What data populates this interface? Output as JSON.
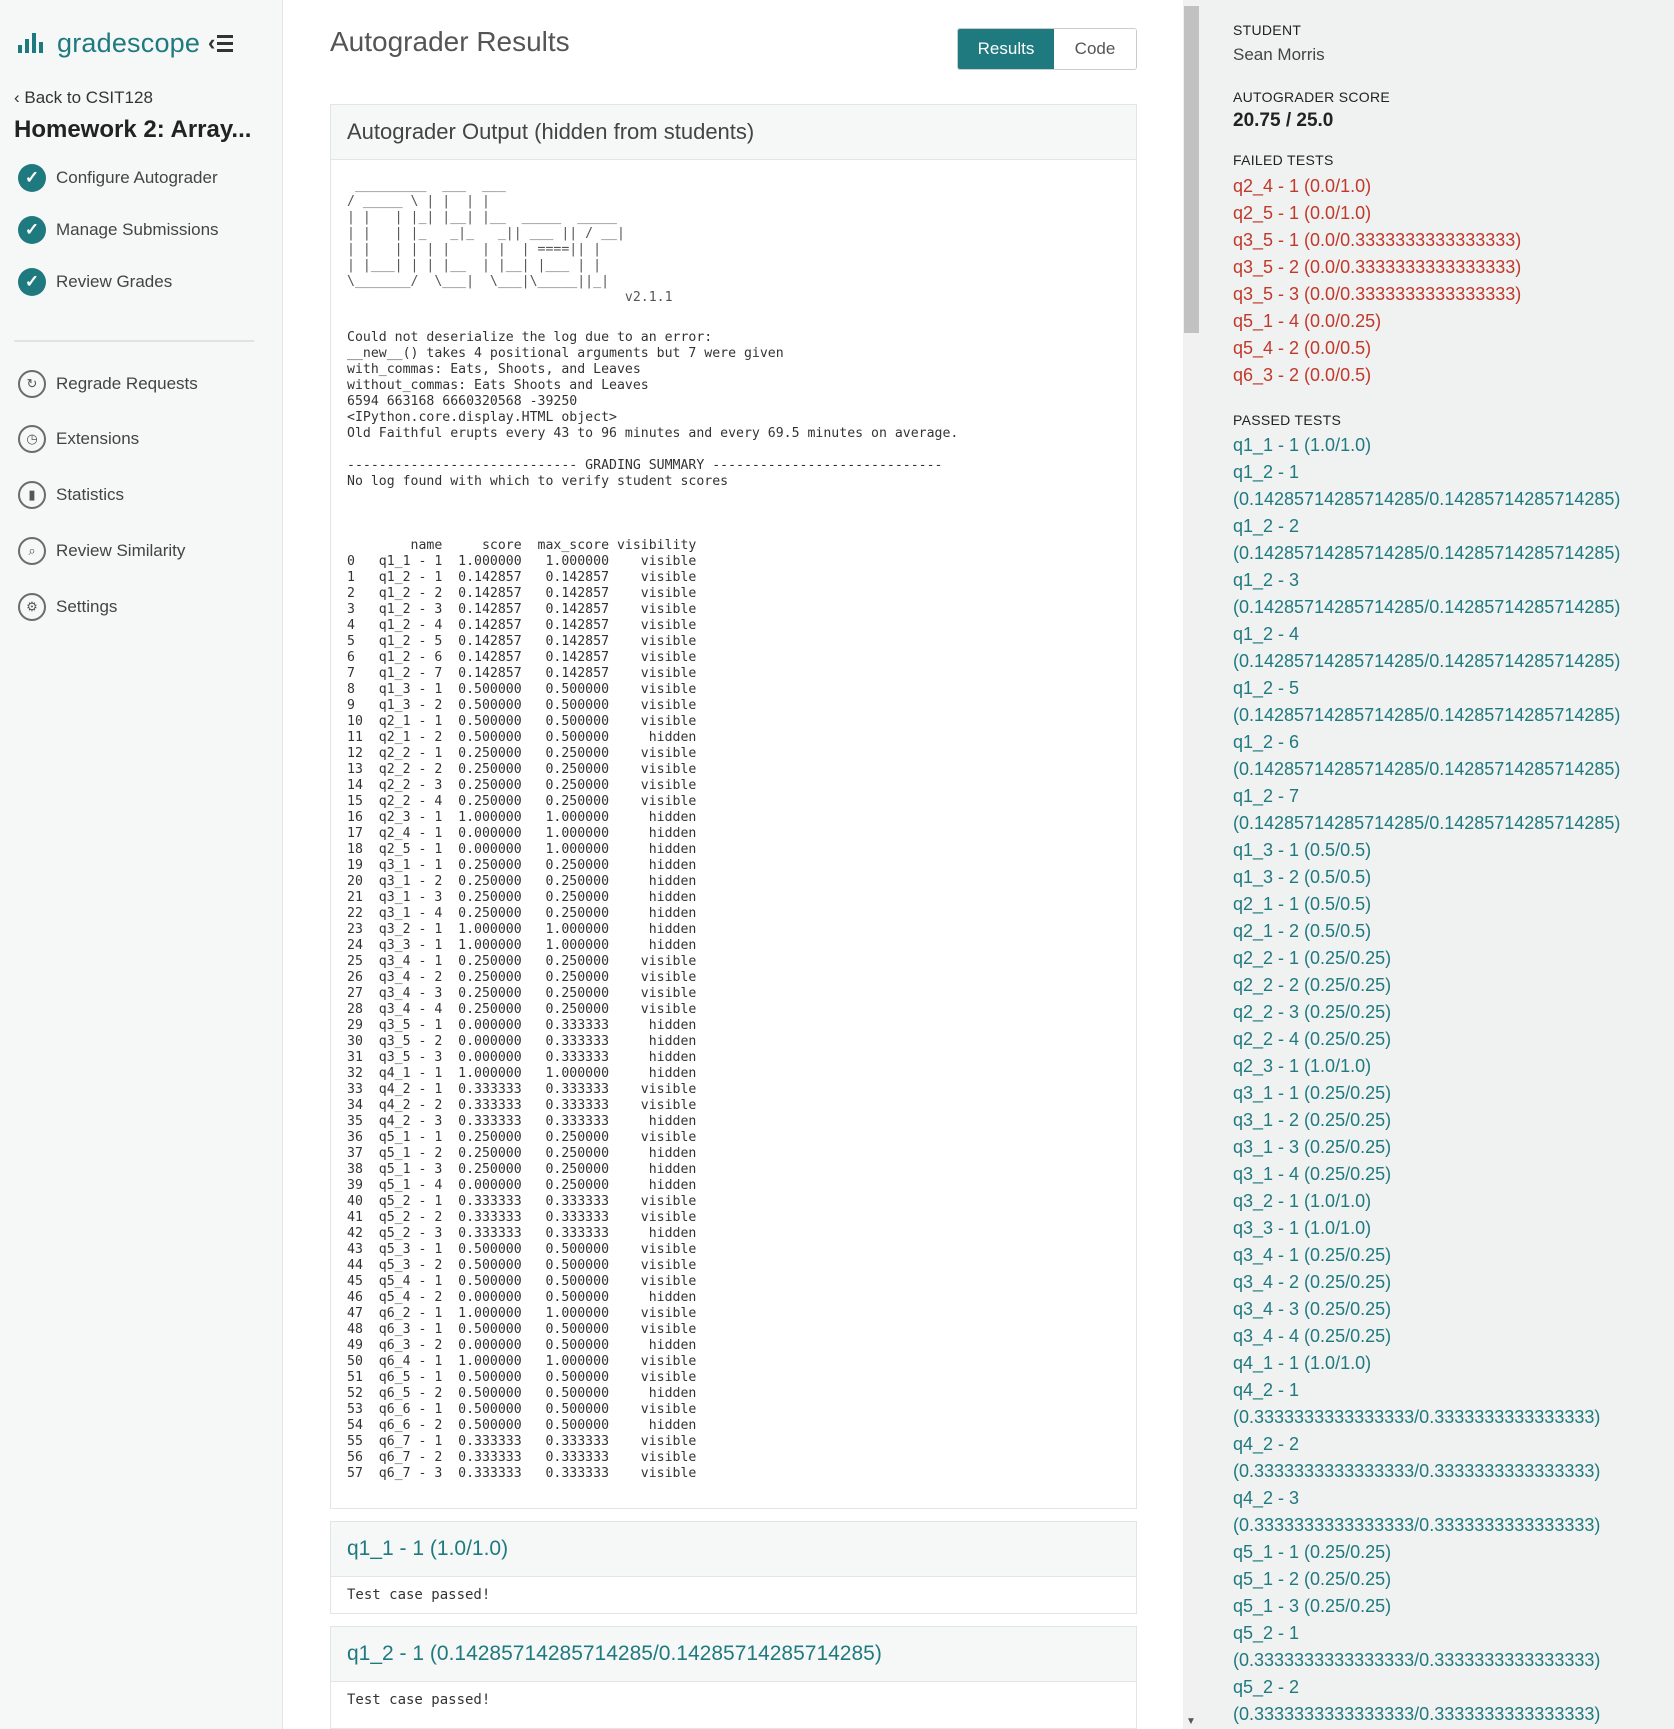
{
  "brand": {
    "name": "gradescope"
  },
  "sidebar": {
    "back_link": "Back to CSIT128",
    "assignment_title": "Homework 2: Array...",
    "steps": [
      {
        "label": "Configure Autograder",
        "icon": "check-circle-icon"
      },
      {
        "label": "Manage Submissions",
        "icon": "check-circle-icon"
      },
      {
        "label": "Review Grades",
        "icon": "check-circle-icon"
      }
    ],
    "tools": [
      {
        "label": "Regrade Requests",
        "icon": "regrade-icon"
      },
      {
        "label": "Extensions",
        "icon": "clock-icon"
      },
      {
        "label": "Statistics",
        "icon": "bar-chart-icon"
      },
      {
        "label": "Review Similarity",
        "icon": "magnifier-icon"
      },
      {
        "label": "Settings",
        "icon": "gear-icon"
      }
    ]
  },
  "main": {
    "title": "Autograder Results",
    "toggle": {
      "results": "Results",
      "code": "Code"
    },
    "output_panel": {
      "heading": "Autograder Output (hidden from students)",
      "logo_ascii": " _________  ___  ___\n/ _____ \\ | |  | |\n| |   | |_| |__| |__  _____  _____\n| |   | |_   _|_   _|| ___ || / __|\n| |   | | | |    | |  | ====|| |\n| |___| | | |__  | |__| |___ | |\n\\_______/  \\___|  \\___|\\_____||_|\n                                   v2.1.1",
      "version": "v2.1.1",
      "text": "Could not deserialize the log due to an error:\n__new__() takes 4 positional arguments but 7 were given\nwith_commas: Eats, Shoots, and Leaves\nwithout_commas: Eats Shoots and Leaves\n6594 663168 6660320568 -39250\n<IPython.core.display.HTML object>\nOld Faithful erupts every 43 to 96 minutes and every 69.5 minutes on average.\n\n----------------------------- GRADING SUMMARY -----------------------------\nNo log found with which to verify student scores\n\n\n\n        name     score  max_score visibility\n0   q1_1 - 1  1.000000   1.000000    visible\n1   q1_2 - 1  0.142857   0.142857    visible\n2   q1_2 - 2  0.142857   0.142857    visible\n3   q1_2 - 3  0.142857   0.142857    visible\n4   q1_2 - 4  0.142857   0.142857    visible\n5   q1_2 - 5  0.142857   0.142857    visible\n6   q1_2 - 6  0.142857   0.142857    visible\n7   q1_2 - 7  0.142857   0.142857    visible\n8   q1_3 - 1  0.500000   0.500000    visible\n9   q1_3 - 2  0.500000   0.500000    visible\n10  q2_1 - 1  0.500000   0.500000    visible\n11  q2_1 - 2  0.500000   0.500000     hidden\n12  q2_2 - 1  0.250000   0.250000    visible\n13  q2_2 - 2  0.250000   0.250000    visible\n14  q2_2 - 3  0.250000   0.250000    visible\n15  q2_2 - 4  0.250000   0.250000    visible\n16  q2_3 - 1  1.000000   1.000000     hidden\n17  q2_4 - 1  0.000000   1.000000     hidden\n18  q2_5 - 1  0.000000   1.000000     hidden\n19  q3_1 - 1  0.250000   0.250000     hidden\n20  q3_1 - 2  0.250000   0.250000     hidden\n21  q3_1 - 3  0.250000   0.250000     hidden\n22  q3_1 - 4  0.250000   0.250000     hidden\n23  q3_2 - 1  1.000000   1.000000     hidden\n24  q3_3 - 1  1.000000   1.000000     hidden\n25  q3_4 - 1  0.250000   0.250000    visible\n26  q3_4 - 2  0.250000   0.250000    visible\n27  q3_4 - 3  0.250000   0.250000    visible\n28  q3_4 - 4  0.250000   0.250000    visible\n29  q3_5 - 1  0.000000   0.333333     hidden\n30  q3_5 - 2  0.000000   0.333333     hidden\n31  q3_5 - 3  0.000000   0.333333     hidden\n32  q4_1 - 1  1.000000   1.000000     hidden\n33  q4_2 - 1  0.333333   0.333333    visible\n34  q4_2 - 2  0.333333   0.333333    visible\n35  q4_2 - 3  0.333333   0.333333     hidden\n36  q5_1 - 1  0.250000   0.250000    visible\n37  q5_1 - 2  0.250000   0.250000     hidden\n38  q5_1 - 3  0.250000   0.250000     hidden\n39  q5_1 - 4  0.000000   0.250000     hidden\n40  q5_2 - 1  0.333333   0.333333    visible\n41  q5_2 - 2  0.333333   0.333333    visible\n42  q5_2 - 3  0.333333   0.333333     hidden\n43  q5_3 - 1  0.500000   0.500000    visible\n44  q5_3 - 2  0.500000   0.500000    visible\n45  q5_4 - 1  0.500000   0.500000    visible\n46  q5_4 - 2  0.000000   0.500000     hidden\n47  q6_2 - 1  1.000000   1.000000    visible\n48  q6_3 - 1  0.500000   0.500000    visible\n49  q6_3 - 2  0.000000   0.500000     hidden\n50  q6_4 - 1  1.000000   1.000000    visible\n51  q6_5 - 1  0.500000   0.500000    visible\n52  q6_5 - 2  0.500000   0.500000     hidden\n53  q6_6 - 1  0.500000   0.500000    visible\n54  q6_6 - 2  0.500000   0.500000     hidden\n55  q6_7 - 1  0.333333   0.333333    visible\n56  q6_7 - 2  0.333333   0.333333    visible\n57  q6_7 - 3  0.333333   0.333333    visible"
    },
    "tests": [
      {
        "heading": "q1_1 - 1 (1.0/1.0)",
        "message": "Test case passed!"
      },
      {
        "heading": "q1_2 - 1 (0.14285714285714285/0.14285714285714285)",
        "message": "Test case passed!"
      }
    ]
  },
  "summary": {
    "student_label": "STUDENT",
    "student_name": "Sean Morris",
    "score_label": "AUTOGRADER SCORE",
    "score": "20.75 / 25.0",
    "failed_label": "FAILED TESTS",
    "failed": [
      "q2_4 - 1 (0.0/1.0)",
      "q2_5 - 1 (0.0/1.0)",
      "q3_5 - 1 (0.0/0.3333333333333333)",
      "q3_5 - 2 (0.0/0.3333333333333333)",
      "q3_5 - 3 (0.0/0.3333333333333333)",
      "q5_1 - 4 (0.0/0.25)",
      "q5_4 - 2 (0.0/0.5)",
      "q6_3 - 2 (0.0/0.5)"
    ],
    "passed_label": "PASSED TESTS",
    "passed": [
      "q1_1 - 1 (1.0/1.0)",
      "q1_2 - 1",
      "(0.14285714285714285/0.14285714285714285)",
      "q1_2 - 2",
      "(0.14285714285714285/0.14285714285714285)",
      "q1_2 - 3",
      "(0.14285714285714285/0.14285714285714285)",
      "q1_2 - 4",
      "(0.14285714285714285/0.14285714285714285)",
      "q1_2 - 5",
      "(0.14285714285714285/0.14285714285714285)",
      "q1_2 - 6",
      "(0.14285714285714285/0.14285714285714285)",
      "q1_2 - 7",
      "(0.14285714285714285/0.14285714285714285)",
      "q1_3 - 1 (0.5/0.5)",
      "q1_3 - 2 (0.5/0.5)",
      "q2_1 - 1 (0.5/0.5)",
      "q2_1 - 2 (0.5/0.5)",
      "q2_2 - 1 (0.25/0.25)",
      "q2_2 - 2 (0.25/0.25)",
      "q2_2 - 3 (0.25/0.25)",
      "q2_2 - 4 (0.25/0.25)",
      "q2_3 - 1 (1.0/1.0)",
      "q3_1 - 1 (0.25/0.25)",
      "q3_1 - 2 (0.25/0.25)",
      "q3_1 - 3 (0.25/0.25)",
      "q3_1 - 4 (0.25/0.25)",
      "q3_2 - 1 (1.0/1.0)",
      "q3_3 - 1 (1.0/1.0)",
      "q3_4 - 1 (0.25/0.25)",
      "q3_4 - 2 (0.25/0.25)",
      "q3_4 - 3 (0.25/0.25)",
      "q3_4 - 4 (0.25/0.25)",
      "q4_1 - 1 (1.0/1.0)",
      "q4_2 - 1",
      "(0.3333333333333333/0.3333333333333333)",
      "q4_2 - 2",
      "(0.3333333333333333/0.3333333333333333)",
      "q4_2 - 3",
      "(0.3333333333333333/0.3333333333333333)",
      "q5_1 - 1 (0.25/0.25)",
      "q5_1 - 2 (0.25/0.25)",
      "q5_1 - 3 (0.25/0.25)",
      "q5_2 - 1",
      "(0.3333333333333333/0.3333333333333333)",
      "q5_2 - 2",
      "(0.3333333333333333/0.3333333333333333)"
    ]
  },
  "colors": {
    "accent": "#1f7a7f",
    "failed": "#c0392b",
    "passed": "#1f7a7f"
  }
}
